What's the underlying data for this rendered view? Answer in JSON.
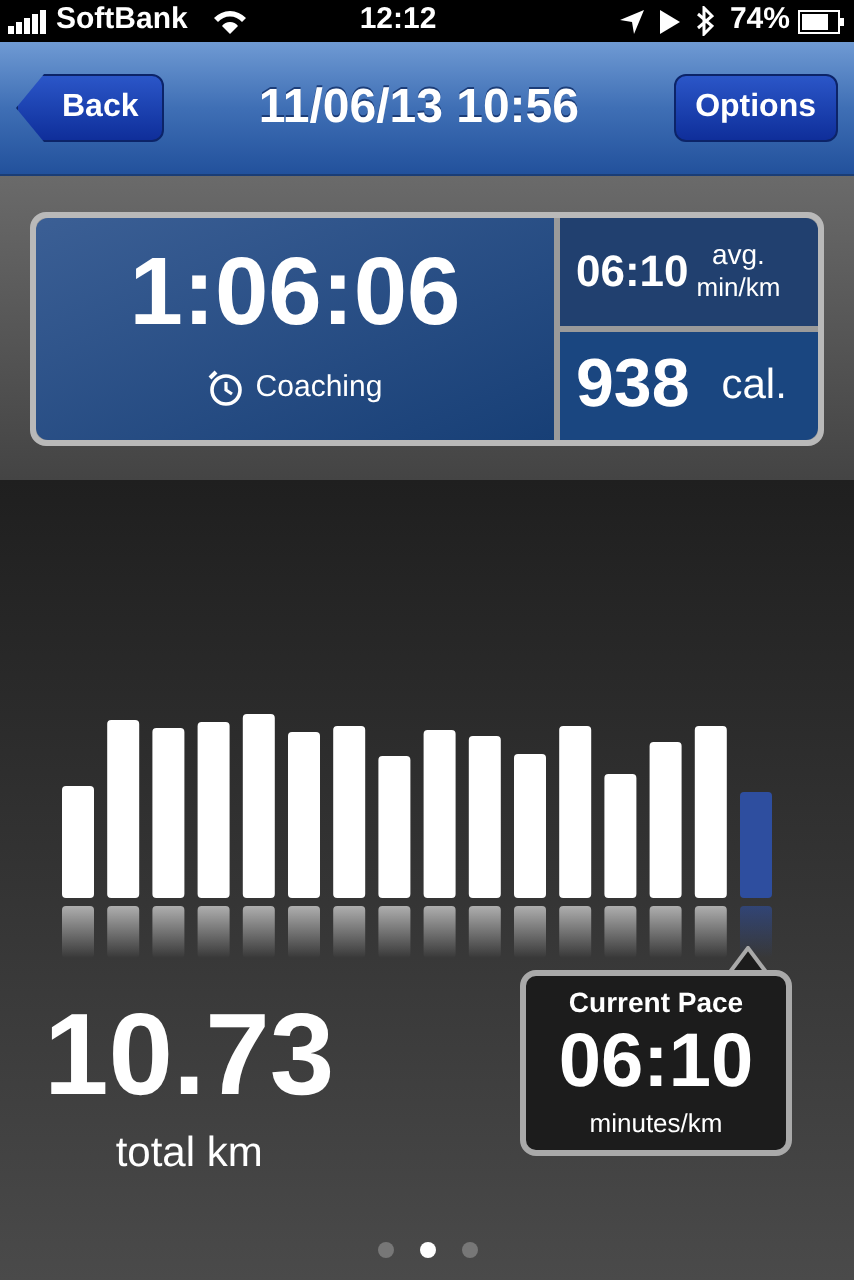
{
  "status_bar": {
    "carrier": "SoftBank",
    "time": "12:12",
    "battery": "74%"
  },
  "nav": {
    "back": "Back",
    "title": "11/06/13 10:56",
    "options": "Options"
  },
  "summary": {
    "duration": "1:06:06",
    "coaching": "Coaching",
    "avg_pace": "06:10",
    "avg_label": "avg.",
    "avg_unit": "min/km",
    "calories": "938",
    "calories_unit": "cal."
  },
  "distance": {
    "value": "10.73",
    "unit": "total km"
  },
  "current_pace": {
    "title": "Current Pace",
    "value": "06:10",
    "unit": "minutes/km"
  },
  "pages": [
    {
      "selected": false
    },
    {
      "selected": true
    },
    {
      "selected": false
    }
  ]
}
